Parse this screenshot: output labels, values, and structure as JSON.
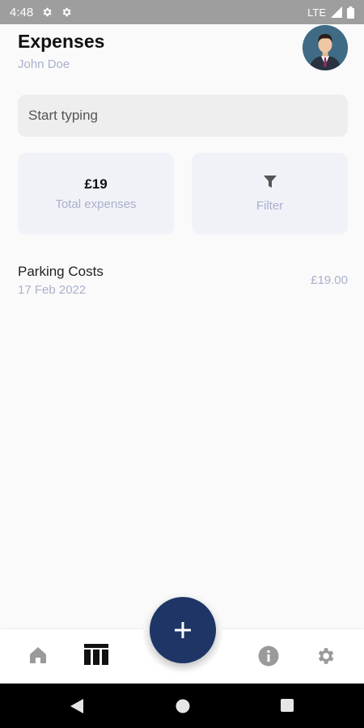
{
  "status_bar": {
    "time": "4:48",
    "network": "LTE"
  },
  "header": {
    "title": "Expenses",
    "user_name": "John Doe"
  },
  "search": {
    "placeholder": "Start typing",
    "value": ""
  },
  "summary": {
    "total_amount": "£19",
    "total_label": "Total expenses",
    "filter_label": "Filter"
  },
  "expenses": [
    {
      "name": "Parking Costs",
      "date": "17 Feb 2022",
      "amount": "£19.00"
    }
  ],
  "colors": {
    "accent": "#1e3566",
    "muted_text": "#aab0cc",
    "card_bg": "#f1f2f8",
    "status_bar": "#9e9e9e"
  },
  "icons": {
    "status_left": [
      "settings-gear-icon",
      "settings-gear-icon"
    ],
    "status_right": [
      "signal-icon",
      "battery-icon"
    ],
    "nav": [
      "home-icon",
      "table-icon",
      "add-icon",
      "info-icon",
      "settings-gear-icon"
    ],
    "system": [
      "back-icon",
      "home-circle-icon",
      "recents-square-icon"
    ]
  }
}
